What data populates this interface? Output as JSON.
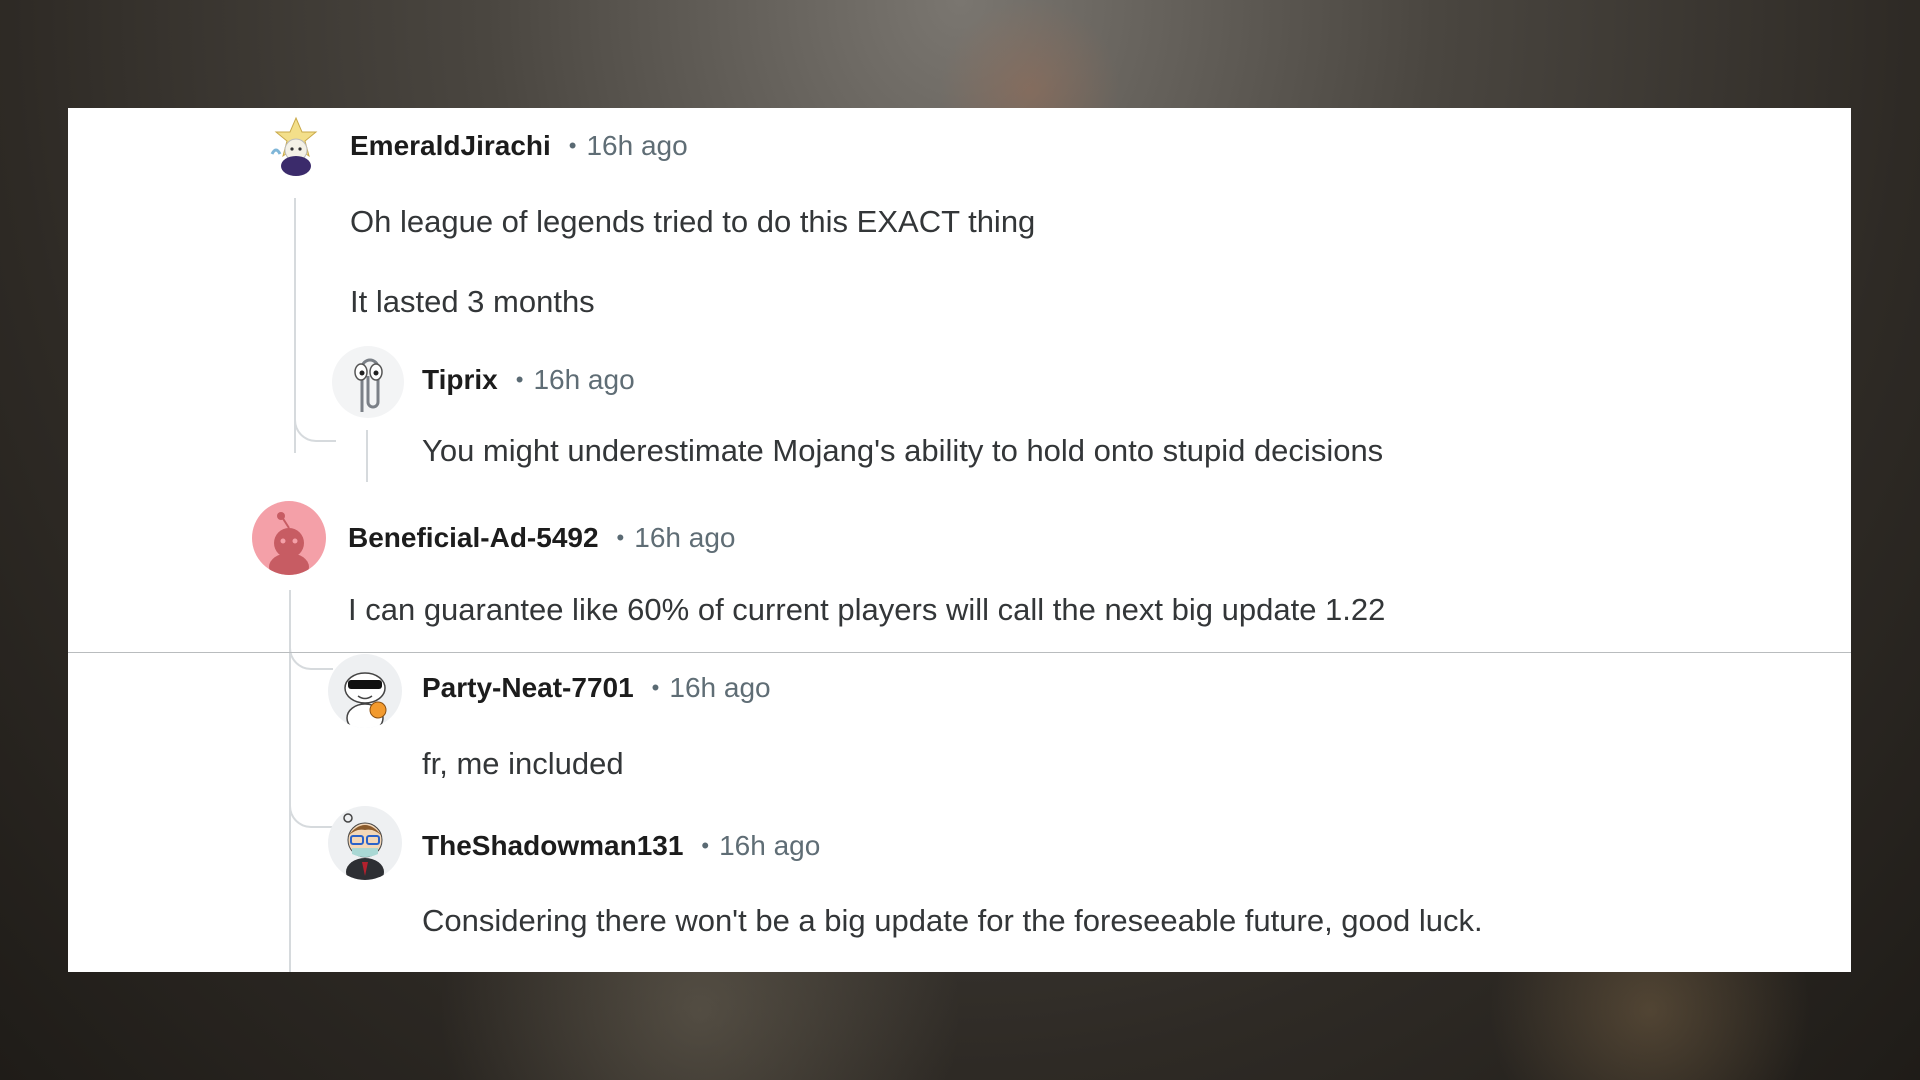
{
  "comments": [
    {
      "username": "EmeraldJirachi",
      "separator": "•",
      "time": "16h ago",
      "lines": [
        "Oh league of legends tried to do this EXACT thing",
        "It lasted 3 months"
      ],
      "avatar_icon": "jirachi-avatar-icon"
    },
    {
      "username": "Tiprix",
      "separator": "•",
      "time": "16h ago",
      "lines": [
        "You might underestimate Mojang's ability to hold onto stupid decisions"
      ],
      "avatar_icon": "paperclip-avatar-icon"
    },
    {
      "username": "Beneficial-Ad-5492",
      "separator": "•",
      "time": "16h ago",
      "lines": [
        "I can guarantee like 60% of current players will call the next big update 1.22"
      ],
      "avatar_icon": "default-snoo-avatar-icon",
      "avatar_color": "#f4a0a8"
    },
    {
      "username": "Party-Neat-7701",
      "separator": "•",
      "time": "16h ago",
      "lines": [
        "fr, me included"
      ],
      "avatar_icon": "sunglasses-snoo-avatar-icon"
    },
    {
      "username": "TheShadowman131",
      "separator": "•",
      "time": "16h ago",
      "lines": [
        "Considering there won't be a big update for the foreseeable future, good luck."
      ],
      "avatar_icon": "masked-snoo-avatar-icon"
    }
  ],
  "colors": {
    "card": "#ffffff",
    "thread_line": "#d6dadd",
    "username": "#1c1c1c",
    "meta": "#5f6d75",
    "body_text": "#333638"
  }
}
